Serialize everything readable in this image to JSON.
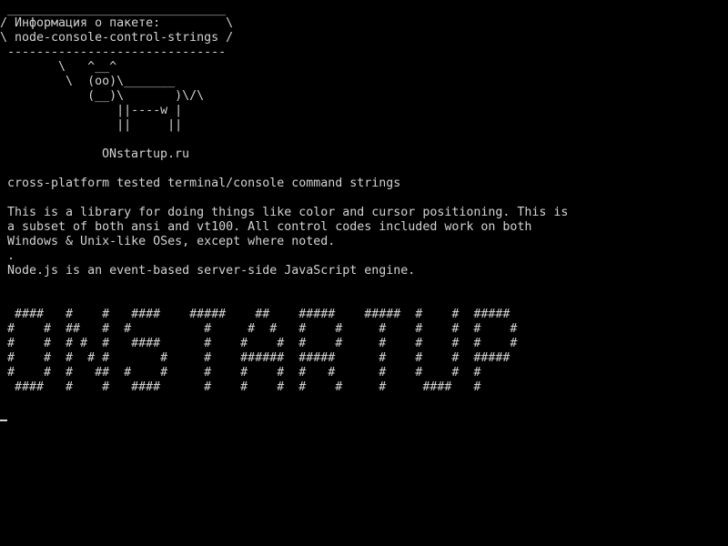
{
  "theme": {
    "background": "#000000",
    "foreground": "#d3d3d3"
  },
  "cowsay": {
    "bubble_top": " ______________________________",
    "bubble_line1": "/ Информация о пакете:         \\",
    "bubble_line2": "\\ node-console-control-strings /",
    "bubble_bottom": " ------------------------------",
    "cow_line1": "        \\   ^__^",
    "cow_line2": "         \\  (oo)\\_______",
    "cow_line3": "            (__)\\       )\\/\\",
    "cow_line4": "                ||----w |",
    "cow_line5": "                ||     ||",
    "site": "ONstartup.ru"
  },
  "description": {
    "summary": " cross-platform tested terminal/console command strings",
    "para_line1": " This is a library for doing things like color and cursor positioning. This is",
    "para_line2": " a subset of both ansi and vt100. All control codes included work on both",
    "para_line3": " Windows & Unix-like OSes, except where noted.",
    "dot": " .",
    "node_line": " Node.js is an event-based server-side JavaScript engine."
  },
  "banner": {
    "row1": "  ####   #    #   ####    #####    ##    #####    #####  #    #  #####",
    "row2": " #    #  ##   #  #          #     #  #   #    #     #    #    #  #    #",
    "row3": " #    #  # #  #   ####      #    #    #  #    #     #    #    #  #    #",
    "row4": " #    #  #  # #       #     #    ######  #####      #    #    #  #####",
    "row5": " #    #  #   ##  #    #     #    #    #  #   #      #    #    #  #",
    "row6": "  ####   #    #   ####      #    #    #  #    #     #     ####   #"
  }
}
